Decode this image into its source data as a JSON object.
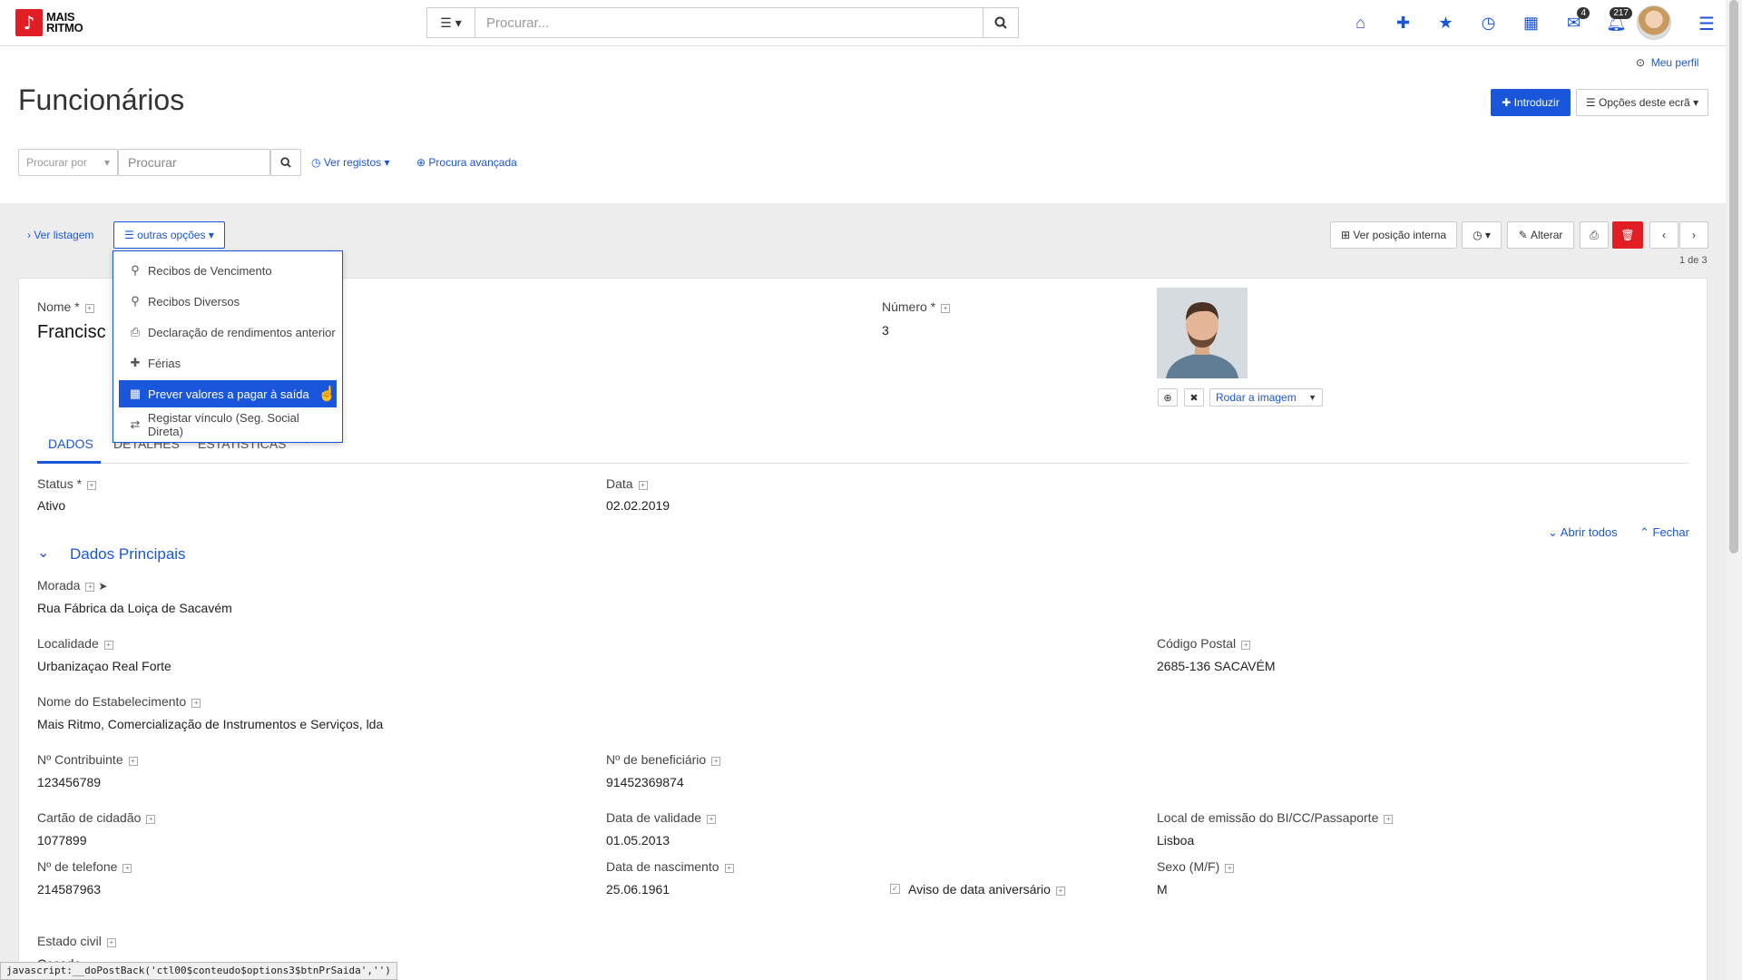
{
  "app": {
    "logo_line1": "MAIS",
    "logo_line2": "RITMO",
    "logo_glyph": "♪"
  },
  "topbar": {
    "search_placeholder": "Procurar...",
    "mail_count": "4",
    "notif_count": "217"
  },
  "profile": {
    "link": "Meu perfil"
  },
  "page": {
    "title": "Funcionários",
    "introduce_label": "Introduzir",
    "options_label": "Opções deste ecrã"
  },
  "filters": {
    "procurar_por": "Procurar por",
    "procurar_placeholder": "Procurar",
    "ver_registos": "Ver registos",
    "procura_avancada": "Procura avançada"
  },
  "toolbar": {
    "ver_listagem": "Ver listagem",
    "outras_opcoes": "outras opções",
    "ver_posicao": "Ver posição interna",
    "alterar": "Alterar",
    "pagination": "1 de 3"
  },
  "dropdown": {
    "items": [
      {
        "icon": "search-icon",
        "label": "Recibos de Vencimento"
      },
      {
        "icon": "search-icon",
        "label": "Recibos Diversos"
      },
      {
        "icon": "print-icon",
        "label": "Declaração de rendimentos anterior"
      },
      {
        "icon": "plus-icon",
        "label": "Férias"
      },
      {
        "icon": "calculator-icon",
        "label": "Prever valores a pagar à saída",
        "active": true
      },
      {
        "icon": "exchange-icon",
        "label": "Registar vínculo (Seg. Social Direta)"
      }
    ]
  },
  "record": {
    "nome_label": "Nome *",
    "nome_value": "Francisc",
    "numero_label": "Número *",
    "numero_value": "3",
    "rodar_imagem": "Rodar a imagem"
  },
  "tabs": [
    "DADOS",
    "DETALHES",
    "ESTATÍSTICAS"
  ],
  "status": {
    "label": "Status *",
    "value": "Ativo"
  },
  "data_field": {
    "label": "Data",
    "value": "02.02.2019"
  },
  "section": {
    "title": "Dados Principais",
    "abrir": "Abrir todos",
    "fechar": "Fechar"
  },
  "fields": {
    "morada": {
      "label": "Morada",
      "value": "Rua Fábrica da Loiça de Sacavém"
    },
    "localidade": {
      "label": "Localidade",
      "value": "Urbanizaçao Real Forte"
    },
    "codigo_postal": {
      "label": "Código Postal",
      "value": "2685-136 SACAVÉM"
    },
    "estabelecimento": {
      "label": "Nome do Estabelecimento",
      "value": "Mais Ritmo, Comercialização de Instrumentos e Serviços, lda"
    },
    "contribuinte": {
      "label": "Nº Contribuinte",
      "value": "123456789"
    },
    "beneficiario": {
      "label": "Nº de beneficiário",
      "value": "91452369874"
    },
    "cartao": {
      "label": "Cartão de cidadão",
      "value": "1077899"
    },
    "validade": {
      "label": "Data de validade",
      "value": "01.05.2013"
    },
    "local_emissao": {
      "label": "Local de emissão do BI/CC/Passaporte",
      "value": "Lisboa"
    },
    "telefone": {
      "label": "Nº de telefone",
      "value": "214587963"
    },
    "nascimento": {
      "label": "Data de nascimento",
      "value": "25.06.1961"
    },
    "aviso": {
      "label": "Aviso de data aniversário"
    },
    "sexo": {
      "label": "Sexo (M/F)",
      "value": "M"
    },
    "estado_civil": {
      "label": "Estado civil",
      "value": "Casado"
    }
  },
  "statusbar": {
    "text": "javascript:__doPostBack('ctl00$conteudo$options3$btnPrSaida','')"
  },
  "colors": {
    "accent": "#1a56db",
    "danger": "#e01e24"
  }
}
